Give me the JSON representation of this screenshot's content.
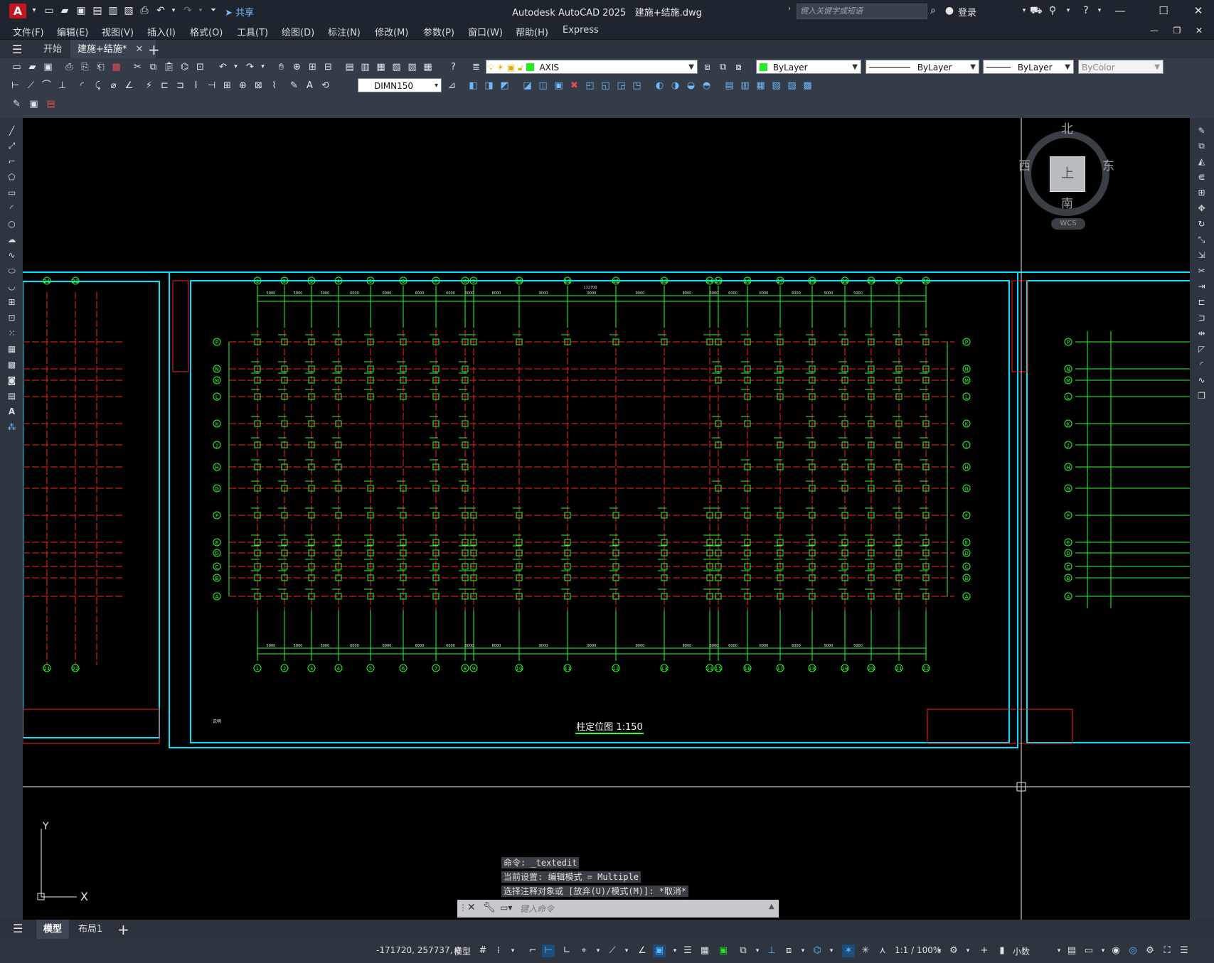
{
  "window": {
    "app_letter": "A",
    "title": "Autodesk AutoCAD 2025",
    "file_name": "建施+结施.dwg",
    "share_label": "共享",
    "search_placeholder": "键入关键字或短语",
    "login_label": "登录"
  },
  "menu": [
    "文件(F)",
    "编辑(E)",
    "视图(V)",
    "插入(I)",
    "格式(O)",
    "工具(T)",
    "绘图(D)",
    "标注(N)",
    "修改(M)",
    "参数(P)",
    "窗口(W)",
    "帮助(H)",
    "Express"
  ],
  "doc_tabs": {
    "start": "开始",
    "active": "建施+结施*"
  },
  "properties": {
    "layer": "AXIS",
    "color": "ByLayer",
    "linetype": "ByLayer",
    "lineweight": "ByLayer",
    "plotstyle": "ByColor",
    "dimstyle": "DIMN150"
  },
  "viewcube": {
    "north": "北",
    "south": "南",
    "east": "东",
    "west": "西",
    "face": "上",
    "wcs": "WCS"
  },
  "drawing": {
    "title": "柱定位图 1:150",
    "total_dim": "112700",
    "ucs_x": "X",
    "ucs_y": "Y",
    "col_labels": [
      "1",
      "2",
      "3",
      "4",
      "5",
      "6",
      "7",
      "8",
      "9",
      "10",
      "11",
      "12",
      "13",
      "14",
      "15",
      "16",
      "17",
      "18",
      "19",
      "20",
      "21",
      "22"
    ],
    "row_labels": [
      "P",
      "N",
      "M",
      "L",
      "K",
      "J",
      "H",
      "G",
      "F",
      "E",
      "D",
      "C",
      "B",
      "A"
    ],
    "top_dims": [
      "5000",
      "5000",
      "5000",
      "6000",
      "6000",
      "6000",
      "6000",
      "6000",
      "8000",
      "9000",
      "9000",
      "9000",
      "8000",
      "6000",
      "6000",
      "6000",
      "6000",
      "5000",
      "5000"
    ],
    "left_panel_cols": [
      "20",
      "21",
      "22"
    ],
    "notes_label": "说明"
  },
  "command": {
    "history": [
      "命令: _textedit",
      "当前设置: 编辑模式 = Multiple",
      "选择注释对象或 [放弃(U)/模式(M)]: *取消*"
    ],
    "placeholder": "键入命令"
  },
  "layout_tabs": {
    "model": "模型",
    "layout1": "布局1"
  },
  "status": {
    "coords": "-171720, 257737, 0",
    "space": "模型",
    "annoscale": "1:1 / 100%",
    "units": "小数"
  },
  "colors": {
    "grid": "#ff1e1e",
    "column": "#2bff2b",
    "frame": "#00e5ff",
    "bg": "#000000"
  }
}
